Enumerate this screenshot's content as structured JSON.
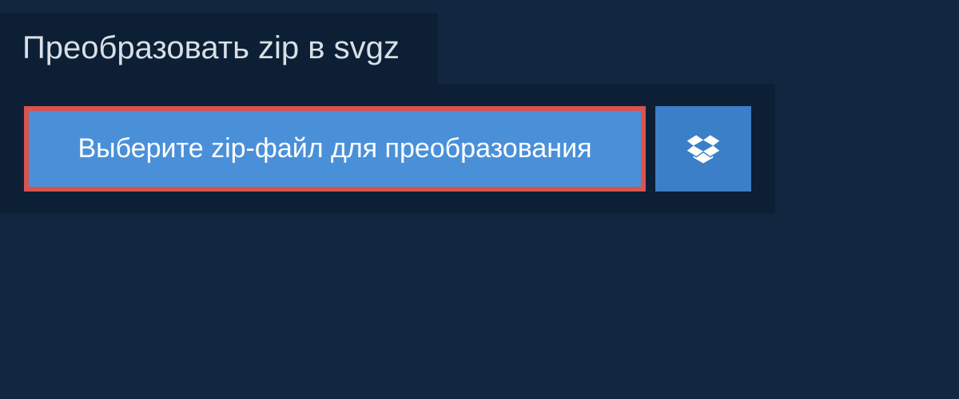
{
  "header": {
    "title": "Преобразовать zip в svgz"
  },
  "upload": {
    "select_file_label": "Выберите zip-файл для преобразования"
  }
}
